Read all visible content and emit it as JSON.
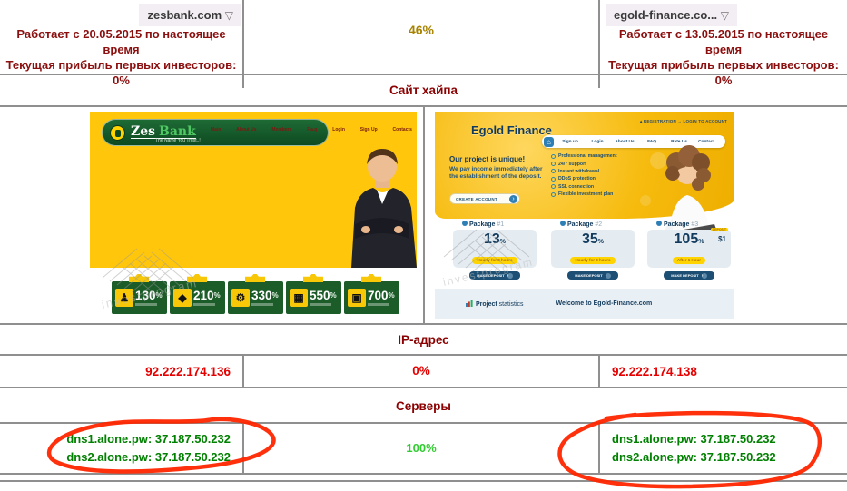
{
  "table": {
    "sections": {
      "site": "Сайт хайпа",
      "ip": "IP-адрес",
      "servers": "Серверы"
    },
    "match": {
      "overall": "46%",
      "ip": "0%",
      "servers": "100%"
    },
    "left": {
      "domain": "zesbank.com",
      "works": "Работает с 20.05.2015 по настоящее время",
      "profit": "Текущая прибыль первых инвесторов: 0%",
      "ip": "92.222.174.136",
      "dns1": "dns1.alone.pw: 37.187.50.232",
      "dns2": "dns2.alone.pw: 37.187.50.232"
    },
    "right": {
      "domain": "egold-finance.co...",
      "works": "Работает с 13.05.2015 по настоящее время",
      "profit": "Текущая прибыль первых инвесторов: 0%",
      "ip": "92.222.174.138",
      "dns1": "dns1.alone.pw: 37.187.50.232",
      "dns2": "dns2.alone.pw: 37.187.50.232"
    }
  },
  "ui": {
    "dropdown_glyph": "▽",
    "home_glyph": "⌂",
    "arrow_glyph": "›",
    "percent": "%"
  },
  "zesbank_site": {
    "logo_zes": "Zes",
    "logo_bank": "Bank",
    "tagline": "The Name You Trust..!",
    "nav": [
      "Main",
      "About Us",
      "Members",
      "F.a.q",
      "Login",
      "Sign Up",
      "Contacts"
    ],
    "plans": [
      {
        "icon": "investor-icon",
        "glyph": "♟",
        "rate": "130"
      },
      {
        "icon": "shield-icon",
        "glyph": "◆",
        "rate": "210"
      },
      {
        "icon": "gears-icon",
        "glyph": "⚙",
        "rate": "330"
      },
      {
        "icon": "chart-icon",
        "glyph": "▦",
        "rate": "550"
      },
      {
        "icon": "briefcase-icon",
        "glyph": "▣",
        "rate": "700"
      }
    ],
    "watermark": "investprogram"
  },
  "egold_site": {
    "logo": "Egold Finance",
    "top_links": "▴ REGISTRATION    → LOGIN TO ACCOUNT",
    "nav": [
      "Sign up",
      "Login",
      "About Us",
      "FAQ",
      "Rate Us",
      "Contact"
    ],
    "headline": "Our project is unique!",
    "subtext1": "We pay income immediately after",
    "subtext2": "the establishment of the deposit.",
    "cta": "CREATE ACCOUNT",
    "features": [
      "Professional management",
      "24/7 support",
      "Instant withdrawal",
      "DDoS protection",
      "SSL connection",
      "Flexible investment plan"
    ],
    "packages": [
      {
        "label": "Package",
        "num": "#1",
        "rate": "13",
        "period": "Hourly for 8 hours"
      },
      {
        "label": "Package",
        "num": "#2",
        "rate": "35",
        "period": "Hourly for 3 hours"
      },
      {
        "label": "Package",
        "num": "#3",
        "rate": "105",
        "period": "After 1 Hour",
        "min": "$1",
        "min_label": "DEPOSIT"
      }
    ],
    "deposit_btn": "MAKE DEPOSIT",
    "footer_stat_bold": "Project",
    "footer_stat_rest": " statistics",
    "footer_welcome": "Welcome to Egold-Finance.com",
    "watermark": "investprogram"
  },
  "colors": {
    "section_header": "#8b0000",
    "date_text": "#8b0f0f",
    "ip_red": "#e60000",
    "dns_green": "#008000",
    "servers_match_green": "#33cc33",
    "name_match_gold": "#a88300",
    "table_border": "#8f8f8f",
    "annotation_red": "#ff2600",
    "zesbank_yellow": "#ffc60b",
    "zesbank_green": "#1c5c28",
    "egold_gold": "#f6bb0e",
    "egold_navy": "#123a5c"
  }
}
